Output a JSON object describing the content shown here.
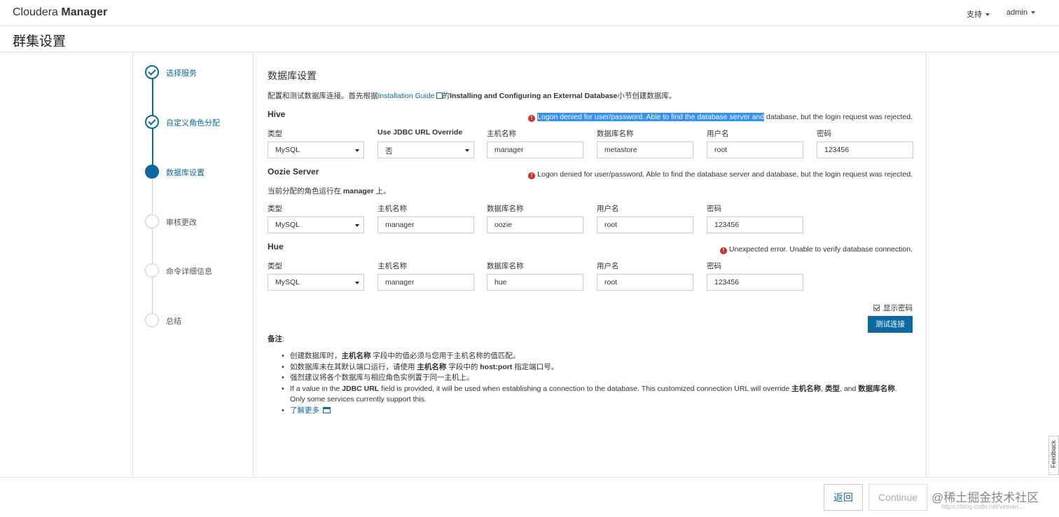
{
  "brand": {
    "prefix": "Cloudera",
    "strong": "Manager"
  },
  "nav": {
    "support": "支持",
    "user": "admin"
  },
  "page_title": "群集设置",
  "steps": [
    {
      "label": "选择服务",
      "state": "done"
    },
    {
      "label": "自定义角色分配",
      "state": "done"
    },
    {
      "label": "数据库设置",
      "state": "active"
    },
    {
      "label": "审核更改",
      "state": "todo"
    },
    {
      "label": "命令详细信息",
      "state": "todo"
    },
    {
      "label": "总结",
      "state": "todo"
    }
  ],
  "main": {
    "title": "数据库设置",
    "intro_before": "配置和测试数据库连接。首先根据",
    "intro_link": "Installation Guide",
    "intro_mid": "的",
    "intro_bold": "Installing and Configuring an External Database",
    "intro_after": "小节创建数据库。",
    "labels": {
      "type": "类型",
      "jdbc": "Use JDBC URL Override",
      "host": "主机名称",
      "dbname": "数据库名称",
      "user": "用户名",
      "password": "密码"
    },
    "hive": {
      "name": "Hive",
      "error_highlight": "Logon denied for user/password. Able to find the database server and",
      "error_rest": " database, but the login request was rejected.",
      "type": "MySQL",
      "jdbc": "否",
      "host": "manager",
      "dbname": "metastore",
      "user": "root",
      "password": "123456"
    },
    "oozie": {
      "name": "Oozie Server",
      "error": "Logon denied for user/password. Able to find the database server and database, but the login request was rejected.",
      "note_before": "当前分配的角色运行在 ",
      "note_host": "manager",
      "note_after": " 上。",
      "type": "MySQL",
      "host": "manager",
      "dbname": "oozie",
      "user": "root",
      "password": "123456"
    },
    "hue": {
      "name": "Hue",
      "error": "Unexpected error. Unable to verify database connection.",
      "type": "MySQL",
      "host": "manager",
      "dbname": "hue",
      "user": "root",
      "password": "123456"
    },
    "show_password": "显示密码",
    "test_button": "测试连接",
    "notes_title": "备注",
    "notes": {
      "n1_a": "创建数据库时，",
      "n1_b": "主机名称",
      "n1_c": " 字段中的值必须与您用于主机名称的值匹配。",
      "n2_a": "如数据库未在其默认端口运行，请使用 ",
      "n2_b": "主机名称",
      "n2_c": " 字段中的 ",
      "n2_d": "host:port",
      "n2_e": " 指定端口号。",
      "n3": "强烈建议将各个数据库与相应角色实例置于同一主机上。",
      "n4_a": "If a value in the ",
      "n4_b": "JDBC URL",
      "n4_c": " field is provided, it will be used when establishing a connection to the database. This customized connection URL will override ",
      "n4_d": "主机名称",
      "n4_e": ", ",
      "n4_f": "类型",
      "n4_g": ", and ",
      "n4_h": "数据库名称",
      "n4_i": ". Only some services currently support this.",
      "learn_more": "了解更多"
    }
  },
  "footer": {
    "back": "返回",
    "continue": "Continue",
    "watermark": "@稀土掘金技术社区",
    "watermark_sub": "https://blog.csdn.net/xinnan..."
  },
  "feedback": "Feedback",
  "colors": {
    "accent": "#0a6aa1",
    "error": "#c9302c",
    "highlight": "#3390ff"
  }
}
